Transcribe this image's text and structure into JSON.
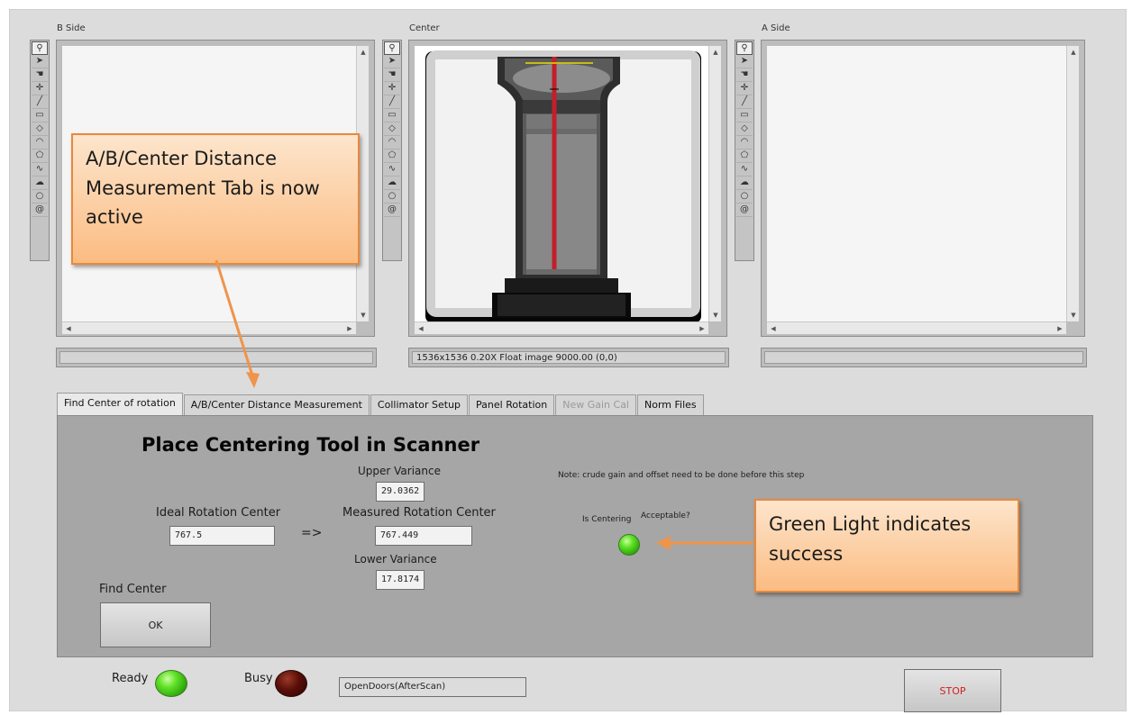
{
  "panels": {
    "b_side": {
      "label": "B Side",
      "status": ""
    },
    "center": {
      "label": "Center",
      "status": "1536x1536 0.20X Float image 9000.00    (0,0)"
    },
    "a_side": {
      "label": "A Side",
      "status": ""
    }
  },
  "tool_icons": [
    "zoom-icon",
    "pointer-icon",
    "pan-hand-icon",
    "crosshair-icon",
    "line-icon",
    "rectangle-icon",
    "rotated-rect-icon",
    "annulus-icon",
    "polygon-icon",
    "freehand-icon",
    "freehand-region-icon",
    "oval-icon",
    "spiral-icon"
  ],
  "tabs": [
    {
      "label": "Find Center of rotation",
      "active": true,
      "disabled": false
    },
    {
      "label": "A/B/Center Distance Measurement",
      "active": false,
      "disabled": false
    },
    {
      "label": "Collimator Setup",
      "active": false,
      "disabled": false
    },
    {
      "label": "Panel Rotation",
      "active": false,
      "disabled": false
    },
    {
      "label": "New Gain Cal",
      "active": false,
      "disabled": true
    },
    {
      "label": "Norm Files",
      "active": false,
      "disabled": false
    }
  ],
  "find_center_tab": {
    "heading": "Place Centering Tool in Scanner",
    "upper_variance_label": "Upper Variance",
    "upper_variance": "29.0362",
    "ideal_label": "Ideal Rotation Center",
    "ideal_value": "767.5",
    "arrow": "=>",
    "measured_label": "Measured Rotation Center",
    "measured_value": "767.449",
    "lower_variance_label": "Lower Variance",
    "lower_variance": "17.8174",
    "note": "Note: crude gain and offset need to be done before this step",
    "acceptable_label_a": "Is Centering",
    "acceptable_label_b": "Acceptable?",
    "acceptable_state": "on",
    "find_center_label": "Find Center",
    "ok_label": "OK"
  },
  "status": {
    "ready_label": "Ready",
    "ready_state": "on",
    "busy_label": "Busy",
    "busy_state": "off",
    "message": "OpenDoors(AfterScan)",
    "stop_label": "STOP"
  },
  "callouts": {
    "tab_note": "A/B/Center Distance Measurement Tab is now active",
    "light_note": "Green Light indicates success"
  },
  "colors": {
    "callout_fill": "#fbbc82",
    "callout_border": "#e8893c",
    "led_green": "#5ee025",
    "led_dark": "#5a0f08",
    "stop_text": "#d21e1e",
    "measure_line": "#c0202a",
    "measure_marker": "#e8e000"
  }
}
